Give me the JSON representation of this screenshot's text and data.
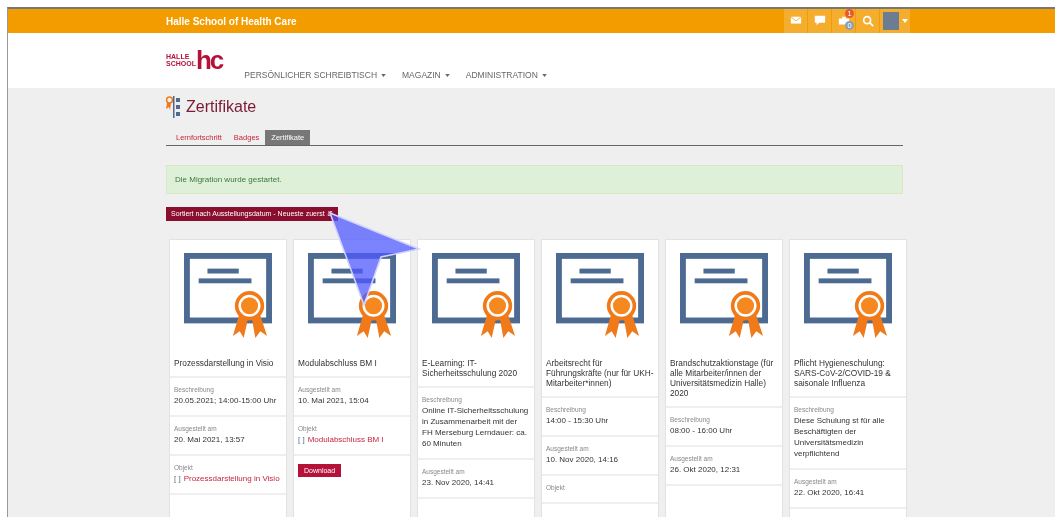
{
  "topbar": {
    "title": "Halle School of Health Care",
    "badges": [
      "1",
      "0"
    ]
  },
  "header": {
    "logo_word1": "HALLE",
    "logo_word2": "SCHOOL",
    "logo_mark": "hc",
    "nav": [
      {
        "label": "PERSÖNLICHER SCHREIBTISCH"
      },
      {
        "label": "MAGAZIN"
      },
      {
        "label": "ADMINISTRATION"
      }
    ]
  },
  "page_title": "Zertifikate",
  "tabs": [
    {
      "label": "Lernfortschritt",
      "selected": false
    },
    {
      "label": "Badges",
      "selected": false
    },
    {
      "label": "Zertifikate",
      "selected": true
    }
  ],
  "alert": "Die Migration wurde gestartet.",
  "sort_button": "Sortiert nach Ausstellungsdatum - Neueste zuerst ⇵",
  "cards": [
    {
      "title": "Prozessdarstellung in Visio",
      "fields": [
        {
          "kind": "text",
          "label": "Beschreibung",
          "value": "20.05.2021; 14:00-15:00 Uhr"
        },
        {
          "kind": "text",
          "label": "Ausgestellt am",
          "value": "20. Mai 2021, 13:57"
        },
        {
          "kind": "object",
          "label": "Objekt",
          "bracket": "[ ]",
          "link": "Prozessdarstellung in Visio"
        }
      ]
    },
    {
      "title": "Modulabschluss BM I",
      "fields": [
        {
          "kind": "text",
          "label": "Ausgestellt am",
          "value": "10. Mai 2021, 15:04"
        },
        {
          "kind": "object",
          "label": "Objekt",
          "bracket": "[ ]",
          "link": "Modulabschluss BM I"
        },
        {
          "kind": "download",
          "button": "Download"
        }
      ]
    },
    {
      "title": "E-Learning: IT-Sicherheitsschulung 2020",
      "fields": [
        {
          "kind": "text",
          "label": "Beschreibung",
          "value": "Online IT-Sicherheitsschulung in Zusammenarbeit mit der FH Merseburg Lerndauer: ca. 60 Minuten"
        },
        {
          "kind": "text",
          "label": "Ausgestellt am",
          "value": "23. Nov 2020, 14:41"
        }
      ]
    },
    {
      "title": "Arbeitsrecht für Führungskräfte (nur für UKH- Mitarbeiter*innen)",
      "fields": [
        {
          "kind": "text",
          "label": "Beschreibung",
          "value": "14:00 - 15:30 Uhr"
        },
        {
          "kind": "text",
          "label": "Ausgestellt am",
          "value": "10. Nov 2020, 14:16"
        },
        {
          "kind": "label",
          "label": "Objekt"
        }
      ]
    },
    {
      "title": "Brandschutzaktionstage (für alle Mitarbeiter/innen der Universitätsmedizin Halle) 2020",
      "fields": [
        {
          "kind": "text",
          "label": "Beschreibung",
          "value": "08:00 - 16:00 Uhr"
        },
        {
          "kind": "text",
          "label": "Ausgestellt am",
          "value": "26. Okt 2020, 12:31"
        }
      ]
    },
    {
      "title": "Pflicht Hygieneschulung: SARS-CoV-2/COVID-19 & saisonale Influenza",
      "fields": [
        {
          "kind": "text",
          "label": "Beschreibung",
          "value": "Diese Schulung st für alle Beschäftigten der Universitätsmedizin verpflichtend"
        },
        {
          "kind": "text",
          "label": "Ausgestellt am",
          "value": "22. Okt 2020, 16:41"
        }
      ]
    }
  ]
}
